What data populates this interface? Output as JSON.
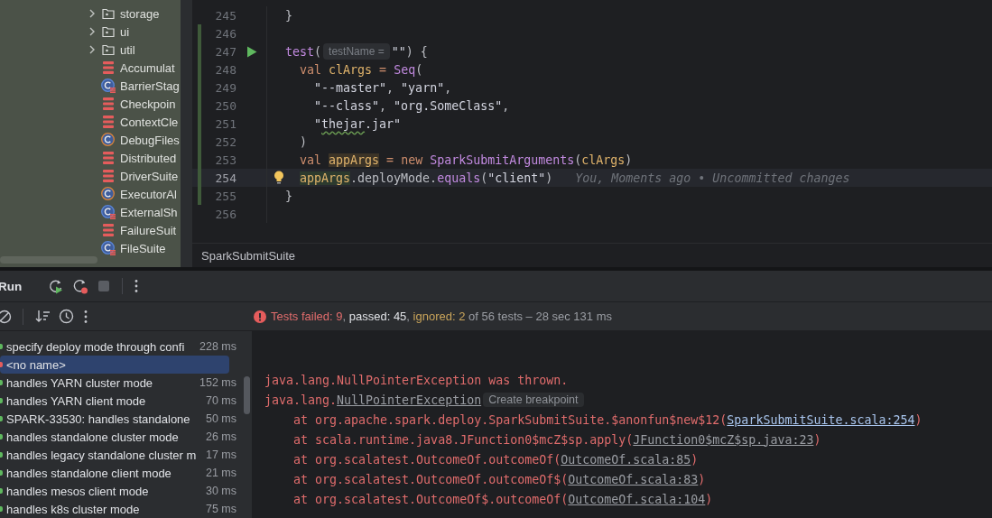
{
  "project_tree": {
    "items": [
      {
        "kind": "folder",
        "name": "storage"
      },
      {
        "kind": "folder",
        "name": "ui"
      },
      {
        "kind": "folder",
        "name": "util"
      },
      {
        "kind": "test",
        "name": "Accumulat"
      },
      {
        "kind": "test-class",
        "name": "BarrierStag"
      },
      {
        "kind": "test",
        "name": "Checkpoin"
      },
      {
        "kind": "test",
        "name": "ContextCle"
      },
      {
        "kind": "class",
        "name": "DebugFiles"
      },
      {
        "kind": "test",
        "name": "Distributed"
      },
      {
        "kind": "test",
        "name": "DriverSuite"
      },
      {
        "kind": "class",
        "name": "ExecutorAl"
      },
      {
        "kind": "test-class",
        "name": "ExternalSh"
      },
      {
        "kind": "test",
        "name": "FailureSuit"
      },
      {
        "kind": "test-class",
        "name": "FileSuite"
      }
    ]
  },
  "editor": {
    "lines": [
      {
        "number": "245",
        "changed": false,
        "current": false,
        "run_marker": false,
        "lightbulb": false,
        "tokens": [
          {
            "kind": "plain",
            "text": "}"
          }
        ]
      },
      {
        "number": "246",
        "changed": true,
        "current": false,
        "run_marker": false,
        "lightbulb": false
      },
      {
        "number": "247",
        "changed": true,
        "current": false,
        "run_marker": true,
        "lightbulb": false,
        "tokens": [
          {
            "kind": "fn",
            "text": "test"
          },
          {
            "kind": "plain",
            "text": "("
          },
          {
            "kind": "hint",
            "text": "testName ="
          },
          {
            "kind": "str",
            "text": "\"\""
          },
          {
            "kind": "plain",
            "text": ") {"
          }
        ]
      },
      {
        "number": "248",
        "changed": true,
        "current": false,
        "run_marker": false,
        "lightbulb": false,
        "tokens": [
          {
            "kind": "kw",
            "text": "  val "
          },
          {
            "kind": "var",
            "text": "clArgs"
          },
          {
            "kind": "op",
            "text": " = "
          },
          {
            "kind": "fn",
            "text": "Seq"
          },
          {
            "kind": "plain",
            "text": "("
          }
        ]
      },
      {
        "number": "249",
        "changed": true,
        "current": false,
        "run_marker": false,
        "lightbulb": false,
        "tokens": [
          {
            "kind": "str",
            "text": "    \"--master\""
          },
          {
            "kind": "plain",
            "text": ", "
          },
          {
            "kind": "str",
            "text": "\"yarn\""
          },
          {
            "kind": "plain",
            "text": ","
          }
        ]
      },
      {
        "number": "250",
        "changed": true,
        "current": false,
        "run_marker": false,
        "lightbulb": false,
        "tokens": [
          {
            "kind": "str",
            "text": "    \"--class\""
          },
          {
            "kind": "plain",
            "text": ", "
          },
          {
            "kind": "str",
            "text": "\"org.SomeClass\""
          },
          {
            "kind": "plain",
            "text": ","
          }
        ]
      },
      {
        "number": "251",
        "changed": true,
        "current": false,
        "run_marker": false,
        "lightbulb": false,
        "tokens": [
          {
            "kind": "str",
            "text": "    \""
          },
          {
            "kind": "typo",
            "text": "thejar"
          },
          {
            "kind": "str",
            "text": ".jar\""
          }
        ]
      },
      {
        "number": "252",
        "changed": true,
        "current": false,
        "run_marker": false,
        "lightbulb": false,
        "tokens": [
          {
            "kind": "plain",
            "text": "  )"
          }
        ]
      },
      {
        "number": "253",
        "changed": true,
        "current": false,
        "run_marker": false,
        "lightbulb": false,
        "tokens": [
          {
            "kind": "kw",
            "text": "  val "
          },
          {
            "kind": "var-def",
            "text": "appArgs"
          },
          {
            "kind": "op",
            "text": " = "
          },
          {
            "kind": "kw",
            "text": "new "
          },
          {
            "kind": "fn",
            "text": "SparkSubmitArguments"
          },
          {
            "kind": "plain",
            "text": "("
          },
          {
            "kind": "var",
            "text": "clArgs"
          },
          {
            "kind": "plain",
            "text": ")"
          }
        ]
      },
      {
        "number": "254",
        "changed": true,
        "current": true,
        "run_marker": false,
        "lightbulb": true,
        "tokens": [
          {
            "kind": "var-use",
            "text": "  appArgs"
          },
          {
            "kind": "plain",
            "text": ".deployMode."
          },
          {
            "kind": "fn",
            "text": "equals"
          },
          {
            "kind": "plain",
            "text": "("
          },
          {
            "kind": "str",
            "text": "\"client\""
          },
          {
            "kind": "plain",
            "text": ")"
          }
        ],
        "blame": "You, Moments ago • Uncommitted changes"
      },
      {
        "number": "255",
        "changed": true,
        "current": false,
        "run_marker": false,
        "lightbulb": false,
        "tokens": [
          {
            "kind": "plain",
            "text": "}"
          }
        ]
      },
      {
        "number": "256",
        "changed": false,
        "current": false,
        "run_marker": false,
        "lightbulb": false
      }
    ],
    "breadcrumb": "SparkSubmitSuite"
  },
  "run_panel": {
    "title": "Run",
    "status": [
      {
        "kind": "failed",
        "text": "Tests failed: 9"
      },
      {
        "kind": "plain",
        "text": ", "
      },
      {
        "kind": "passed",
        "text": "passed: 45"
      },
      {
        "kind": "plain",
        "text": ", "
      },
      {
        "kind": "ignored",
        "text": "ignored: 2"
      },
      {
        "kind": "muted",
        "text": " of 56 tests – 28 sec 131 ms"
      }
    ],
    "tests": [
      {
        "name": "specify deploy mode through confi",
        "duration": "228 ms",
        "failed": false,
        "selected": false
      },
      {
        "name": "<no name>",
        "failed": true,
        "selected": true
      },
      {
        "name": "handles YARN cluster mode",
        "duration": "152 ms",
        "failed": false,
        "selected": false
      },
      {
        "name": "handles YARN client mode",
        "duration": "70 ms",
        "failed": false,
        "selected": false
      },
      {
        "name": "SPARK-33530: handles standalone",
        "duration": "50 ms",
        "failed": false,
        "selected": false
      },
      {
        "name": "handles standalone cluster mode",
        "duration": "26 ms",
        "failed": false,
        "selected": false
      },
      {
        "name": "handles legacy standalone cluster m",
        "duration": "17 ms",
        "failed": false,
        "selected": false
      },
      {
        "name": "handles standalone client mode",
        "duration": "21 ms",
        "failed": false,
        "selected": false
      },
      {
        "name": "handles mesos client mode",
        "duration": "30 ms",
        "failed": false,
        "selected": false
      },
      {
        "name": "handles k8s cluster mode",
        "duration": "75 ms",
        "failed": false,
        "selected": false
      }
    ],
    "console": [
      [
        {
          "kind": "error",
          "text": "java.lang.NullPointerException was thrown."
        }
      ],
      [
        {
          "kind": "error",
          "text": "java.lang."
        },
        {
          "kind": "link",
          "text": "NullPointerException"
        },
        {
          "kind": "chip",
          "text": "Create breakpoint"
        }
      ],
      [
        {
          "kind": "error",
          "text": "    at org.apache.spark.deploy.SparkSubmitSuite.$anonfun$new$12("
        },
        {
          "kind": "link-own",
          "text": "SparkSubmitSuite.scala:254"
        },
        {
          "kind": "error",
          "text": ")"
        }
      ],
      [
        {
          "kind": "error",
          "text": "    at scala.runtime.java8.JFunction0$mcZ$sp.apply("
        },
        {
          "kind": "link",
          "text": "JFunction0$mcZ$sp.java:23"
        },
        {
          "kind": "error",
          "text": ")"
        }
      ],
      [
        {
          "kind": "error",
          "text": "    at org.scalatest.OutcomeOf.outcomeOf("
        },
        {
          "kind": "link",
          "text": "OutcomeOf.scala:85"
        },
        {
          "kind": "error",
          "text": ")"
        }
      ],
      [
        {
          "kind": "error",
          "text": "    at org.scalatest.OutcomeOf.outcomeOf$("
        },
        {
          "kind": "link",
          "text": "OutcomeOf.scala:83"
        },
        {
          "kind": "error",
          "text": ")"
        }
      ],
      [
        {
          "kind": "error",
          "text": "    at org.scalatest.OutcomeOf$.outcomeOf("
        },
        {
          "kind": "link",
          "text": "OutcomeOf.scala:104"
        },
        {
          "kind": "error",
          "text": ")"
        }
      ]
    ]
  }
}
